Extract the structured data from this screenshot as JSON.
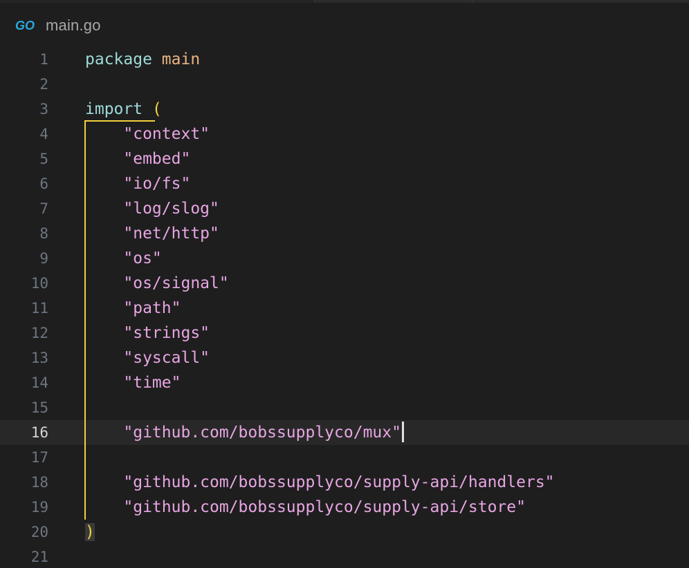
{
  "tab": {
    "icon": "go-file-icon",
    "filename": "main.go"
  },
  "editor": {
    "current_line": 16,
    "lines": [
      {
        "n": "1",
        "tokens": [
          {
            "t": "package",
            "c": "kw"
          },
          {
            "t": " ",
            "c": ""
          },
          {
            "t": "main",
            "c": "pkg"
          }
        ]
      },
      {
        "n": "2",
        "tokens": []
      },
      {
        "n": "3",
        "tokens": [
          {
            "t": "import",
            "c": "kw"
          },
          {
            "t": " ",
            "c": ""
          },
          {
            "t": "(",
            "c": "paren"
          }
        ]
      },
      {
        "n": "4",
        "tokens": [
          {
            "t": "    ",
            "c": ""
          },
          {
            "t": "\"context\"",
            "c": "str"
          }
        ]
      },
      {
        "n": "5",
        "tokens": [
          {
            "t": "    ",
            "c": ""
          },
          {
            "t": "\"embed\"",
            "c": "str"
          }
        ]
      },
      {
        "n": "6",
        "tokens": [
          {
            "t": "    ",
            "c": ""
          },
          {
            "t": "\"io/fs\"",
            "c": "str"
          }
        ]
      },
      {
        "n": "7",
        "tokens": [
          {
            "t": "    ",
            "c": ""
          },
          {
            "t": "\"log/slog\"",
            "c": "str"
          }
        ]
      },
      {
        "n": "8",
        "tokens": [
          {
            "t": "    ",
            "c": ""
          },
          {
            "t": "\"net/http\"",
            "c": "str"
          }
        ]
      },
      {
        "n": "9",
        "tokens": [
          {
            "t": "    ",
            "c": ""
          },
          {
            "t": "\"os\"",
            "c": "str"
          }
        ]
      },
      {
        "n": "10",
        "tokens": [
          {
            "t": "    ",
            "c": ""
          },
          {
            "t": "\"os/signal\"",
            "c": "str"
          }
        ]
      },
      {
        "n": "11",
        "tokens": [
          {
            "t": "    ",
            "c": ""
          },
          {
            "t": "\"path\"",
            "c": "str"
          }
        ]
      },
      {
        "n": "12",
        "tokens": [
          {
            "t": "    ",
            "c": ""
          },
          {
            "t": "\"strings\"",
            "c": "str"
          }
        ]
      },
      {
        "n": "13",
        "tokens": [
          {
            "t": "    ",
            "c": ""
          },
          {
            "t": "\"syscall\"",
            "c": "str"
          }
        ]
      },
      {
        "n": "14",
        "tokens": [
          {
            "t": "    ",
            "c": ""
          },
          {
            "t": "\"time\"",
            "c": "str"
          }
        ]
      },
      {
        "n": "15",
        "tokens": []
      },
      {
        "n": "16",
        "tokens": [
          {
            "t": "    ",
            "c": ""
          },
          {
            "t": "\"github.com/bobssupplyco/mux\"",
            "c": "str"
          }
        ],
        "cursor": true
      },
      {
        "n": "17",
        "tokens": []
      },
      {
        "n": "18",
        "tokens": [
          {
            "t": "    ",
            "c": ""
          },
          {
            "t": "\"github.com/bobssupplyco/supply-api/handlers\"",
            "c": "str"
          }
        ]
      },
      {
        "n": "19",
        "tokens": [
          {
            "t": "    ",
            "c": ""
          },
          {
            "t": "\"github.com/bobssupplyco/supply-api/store\"",
            "c": "str"
          }
        ]
      },
      {
        "n": "20",
        "tokens": [
          {
            "t": ")",
            "c": "paren paren-match"
          }
        ]
      },
      {
        "n": "21",
        "tokens": []
      }
    ]
  },
  "colors": {
    "background": "#1e1e1e",
    "keyword": "#9fd9d9",
    "package_name": "#e9b384",
    "string": "#e7a6e3",
    "bracket": "#f3d23f",
    "line_number": "#6e7681"
  }
}
